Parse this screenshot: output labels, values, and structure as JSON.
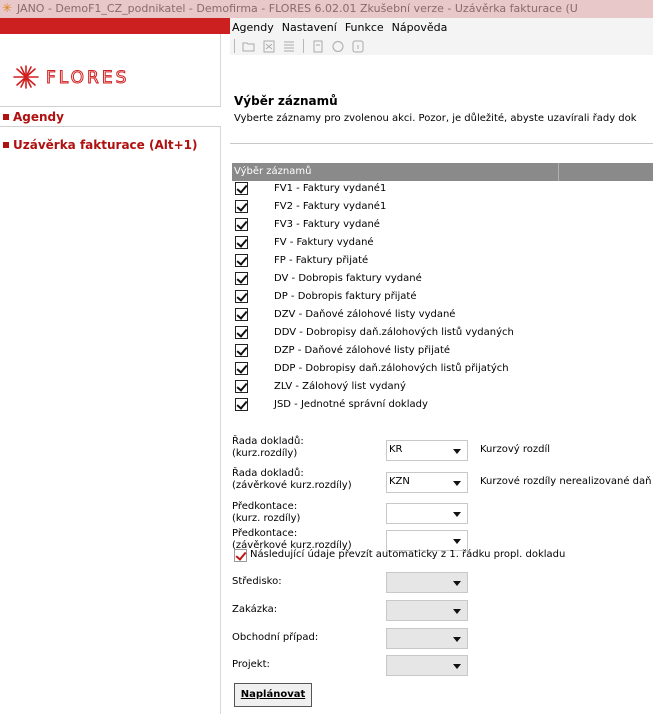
{
  "window": {
    "title": "JANO - DemoF1_CZ_podnikatel - Demofirma - FLORES 6.02.01 Zkušební verze - Uzávěrka fakturace (U"
  },
  "sidebar": {
    "logo_text": "FLORES",
    "items": [
      {
        "label": "Agendy"
      },
      {
        "label": "Uzávěrka fakturace (Alt+1)"
      }
    ]
  },
  "menubar": {
    "items": [
      "Agendy",
      "Nastavení",
      "Funkce",
      "Nápověda"
    ]
  },
  "toolbar": {
    "icons": [
      "folder-open-icon",
      "close-doc-icon",
      "list-icon",
      "page-icon",
      "help-circle-icon",
      "info-icon"
    ]
  },
  "page": {
    "heading": "Výběr záznamů",
    "subtext": "Vyberte záznamy pro zvolenou akci. Pozor, je důležité, abyste uzavírali řady dok"
  },
  "list": {
    "header": "Výběr záznamů",
    "rows": [
      {
        "label": "FV1 - Faktury vydané1",
        "checked": true
      },
      {
        "label": "FV2 - Faktury vydané1",
        "checked": true
      },
      {
        "label": "FV3 - Faktury vydané",
        "checked": true
      },
      {
        "label": "FV - Faktury vydané",
        "checked": true
      },
      {
        "label": "FP - Faktury přijaté",
        "checked": true
      },
      {
        "label": "DV - Dobropis faktury vydané",
        "checked": true
      },
      {
        "label": "DP - Dobropis faktury přijaté",
        "checked": true
      },
      {
        "label": "DZV - Daňové zálohové listy vydané",
        "checked": true
      },
      {
        "label": "DDV - Dobropisy daň.zálohových listů vydaných",
        "checked": true
      },
      {
        "label": "DZP - Daňové zálohové listy přijaté",
        "checked": true
      },
      {
        "label": "DDP - Dobropisy daň.zálohových listů přijatých",
        "checked": true
      },
      {
        "label": "ZLV - Zálohový list vydaný",
        "checked": true
      },
      {
        "label": "JSD - Jednotné správní doklady",
        "checked": true
      }
    ]
  },
  "form": {
    "rada_kurz": {
      "label1": "Řada dokladů:",
      "label2": "(kurz.rozdíly)",
      "value": "KR",
      "desc": "Kurzový rozdíl"
    },
    "rada_zav": {
      "label1": "Řada dokladů:",
      "label2": "(závěrkové kurz.rozdíly)",
      "value": "KZN",
      "desc": "Kurzové rozdíly nerealizované daň"
    },
    "predk_kurz": {
      "label1": "Předkontace:",
      "label2": "(kurz. rozdíly)",
      "value": ""
    },
    "predk_zav": {
      "label1": "Předkontace:",
      "label2": "(závěrkové kurz.rozdíly)",
      "value": ""
    },
    "auto_label": "Následující údaje převzít automaticky z 1. řádku propl. dokladu",
    "auto_checked": true,
    "stredisko": "Středisko:",
    "zakazka": "Zakázka:",
    "obchodni": "Obchodní případ:",
    "projekt": "Projekt:",
    "button": "Naplánovat"
  },
  "colors": {
    "accent_red": "#cc1f1f",
    "sidebar_text_red": "#b01010",
    "list_header_gray": "#8a8a8a"
  }
}
